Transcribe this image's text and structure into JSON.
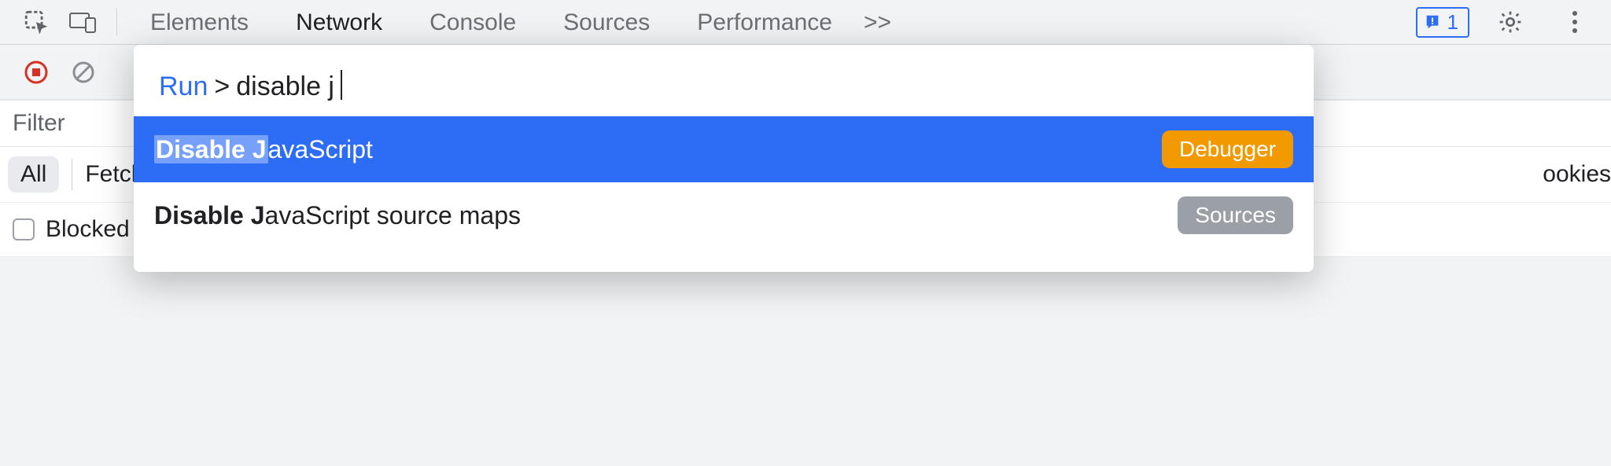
{
  "tabs": {
    "elements": "Elements",
    "network": "Network",
    "console": "Console",
    "sources": "Sources",
    "performance": "Performance",
    "overflow": ">>"
  },
  "badge": {
    "count": "1"
  },
  "filter": {
    "placeholder": "Filter"
  },
  "pills": {
    "all": "All",
    "fetch": "Fetch",
    "cookies_peek": "ookies"
  },
  "blocked": {
    "label": "Blocked"
  },
  "palette": {
    "run": "Run",
    "chevron": ">",
    "query": "disable j",
    "results": [
      {
        "hl": "Disable J",
        "rest": "avaScript",
        "tag": "Debugger",
        "tagColor": "orange",
        "selected": true
      },
      {
        "hl": "Disable J",
        "rest": "avaScript source maps",
        "tag": "Sources",
        "tagColor": "grey",
        "selected": false
      }
    ]
  }
}
